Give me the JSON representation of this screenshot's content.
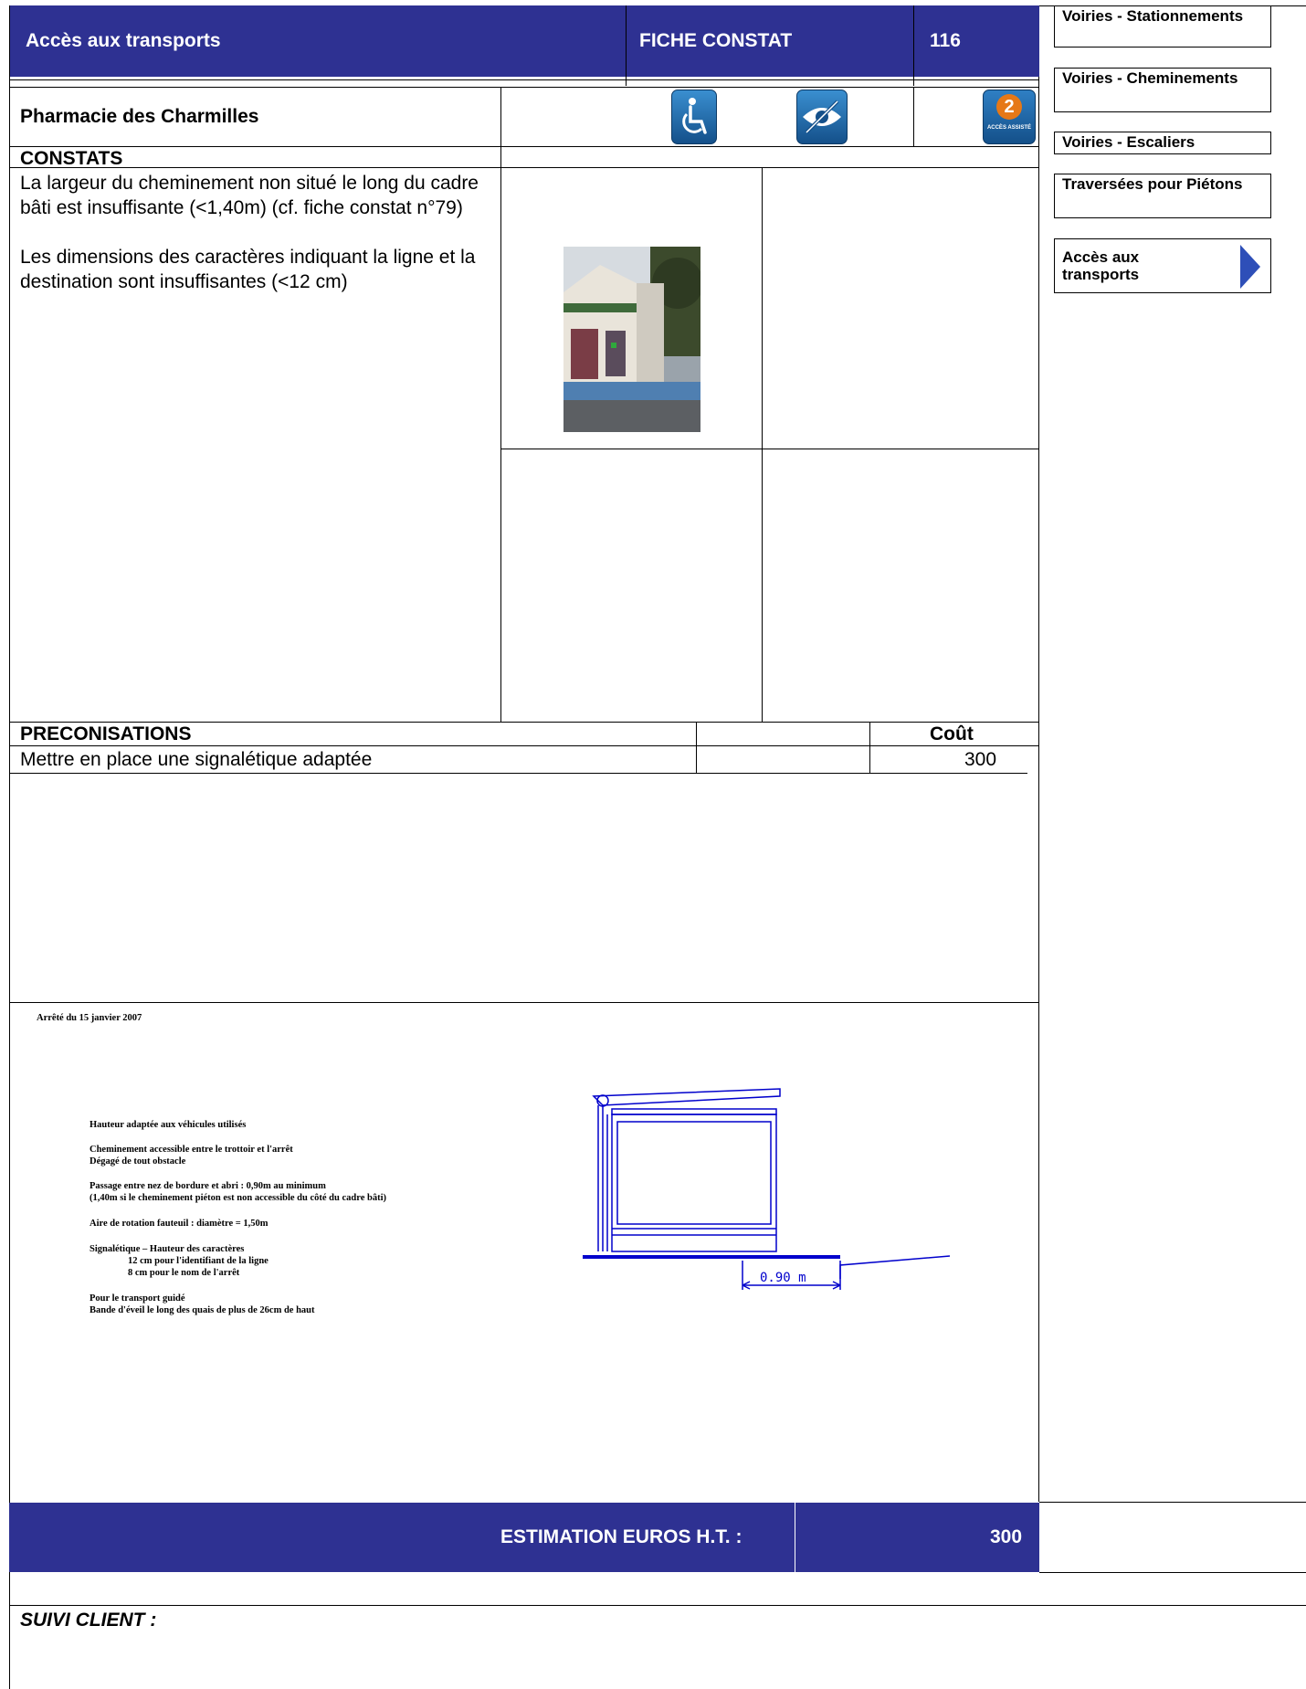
{
  "header": {
    "category": "Accès aux transports",
    "fiche_label": "FICHE CONSTAT",
    "fiche_number": "116"
  },
  "site": {
    "name": "Pharmacie des Charmilles"
  },
  "icons": [
    {
      "name": "wheelchair-icon",
      "symbol": "♿",
      "color": "#1a6aa8"
    },
    {
      "name": "visual-impairment-icon",
      "symbol": "eye",
      "color": "#1a6aa8"
    },
    {
      "name": "acces-assiste-icon",
      "number": "2",
      "caption": "ACCÈS ASSISTÉ",
      "color": "#e67817"
    }
  ],
  "nav": {
    "items": [
      {
        "label": "Voiries - Stationnements"
      },
      {
        "label": "Voiries - Cheminements"
      },
      {
        "label": "Voiries - Escaliers"
      },
      {
        "label": "Traversées pour Piétons"
      },
      {
        "label": "Accès aux transports",
        "active": true
      }
    ]
  },
  "constats": {
    "heading": "CONSTATS",
    "text_1": "La largeur du cheminement non situé le long du cadre bâti est insuffisante (<1,40m) (cf. fiche constat n°79)",
    "text_2": "Les dimensions des caractères indiquant la ligne et la destination sont insuffisantes (<12 cm)"
  },
  "preconisations": {
    "heading": "PRECONISATIONS",
    "cost_header": "Coût",
    "items": [
      {
        "label": "Mettre en place une signalétique adaptée",
        "cost": "300"
      }
    ]
  },
  "reference": {
    "title": "Arrêté du 15 janvier 2007",
    "lines": [
      "Hauteur adaptée aux véhicules utilisés",
      "Cheminement accessible entre le trottoir et l'arrêt",
      "Dégagé de tout obstacle",
      "Passage entre nez de bordure et abri : 0,90m au minimum",
      "(1,40m si le cheminement piéton est non accessible du côté du cadre bâti)",
      "Aire de rotation fauteuil : diamètre = 1,50m",
      "Signalétique – Hauteur des caractères",
      "12 cm pour l'identifiant de la ligne",
      "8 cm pour le nom de l'arrêt",
      "Pour le transport guidé",
      "Bande d'éveil le long des quais de plus de 26cm de haut"
    ],
    "dimension_label": "0.90 m"
  },
  "estimation": {
    "label": "ESTIMATION EUROS H.T. :",
    "value": "300"
  },
  "suivi": {
    "label": "SUIVI CLIENT :"
  },
  "colors": {
    "header_bg": "#2e3192",
    "nav_arrow": "#2e4fb8",
    "drawing": "#0000cc"
  }
}
